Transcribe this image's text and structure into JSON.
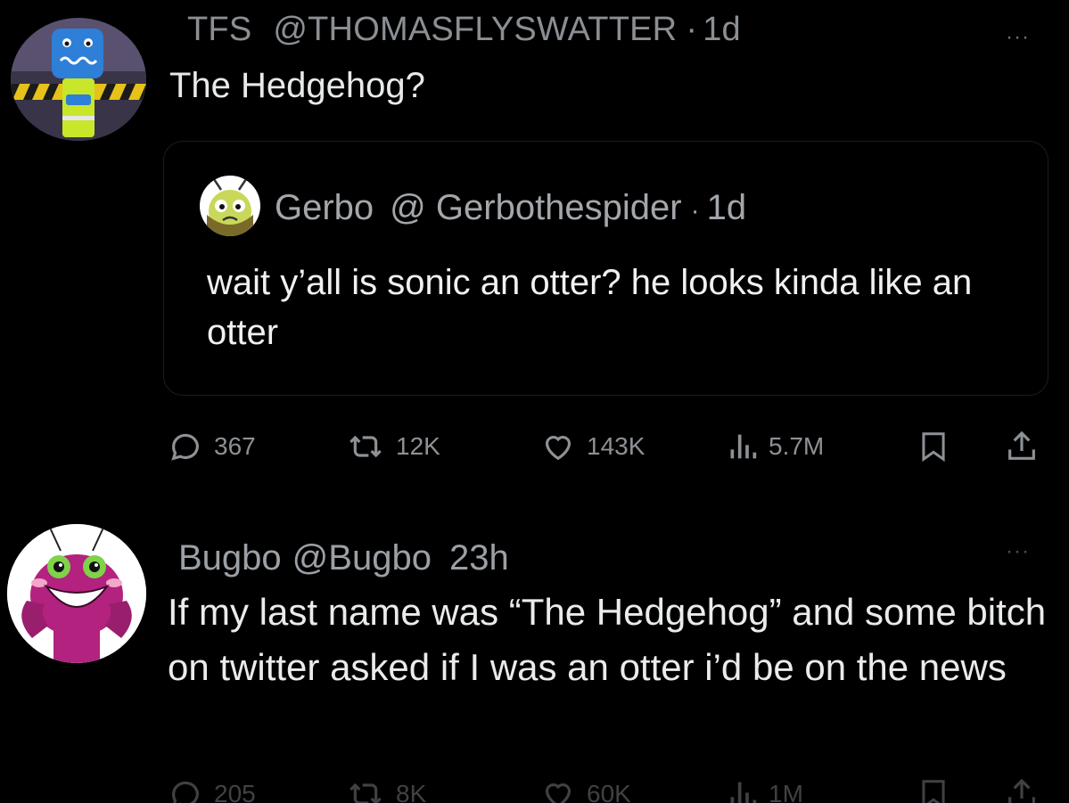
{
  "tweet1": {
    "display_name": "TFS",
    "handle": "@THOMASFLYSWATTER",
    "separator": "·",
    "time": "1d",
    "more": "···",
    "text": "The Hedgehog?",
    "quote": {
      "display_name": "Gerbo",
      "handle": "@ Gerbothespider",
      "separator": "·",
      "time": "1d",
      "text": "wait y’all is sonic an otter? he looks kinda like an otter"
    },
    "stats": {
      "replies": "367",
      "reposts": "12K",
      "likes": "143K",
      "views": "5.7M"
    }
  },
  "tweet2": {
    "display_name": "Bugbo",
    "handle": "@Bugbo",
    "time": "23h",
    "more": "···",
    "text": "If my last name was “The Hedgehog” and some bitch on twitter asked if I was an otter i’d be on the news",
    "stats": {
      "replies": "205",
      "reposts": "8K",
      "likes": "60K",
      "views": "1M"
    }
  },
  "icons": {
    "reply": "reply-icon",
    "repost": "repost-icon",
    "like": "heart-icon",
    "views": "views-icon",
    "bookmark": "bookmark-icon",
    "share": "share-icon"
  },
  "colors": {
    "background": "#000000",
    "text_primary": "#e7e9ea",
    "text_secondary": "#8d9195"
  }
}
